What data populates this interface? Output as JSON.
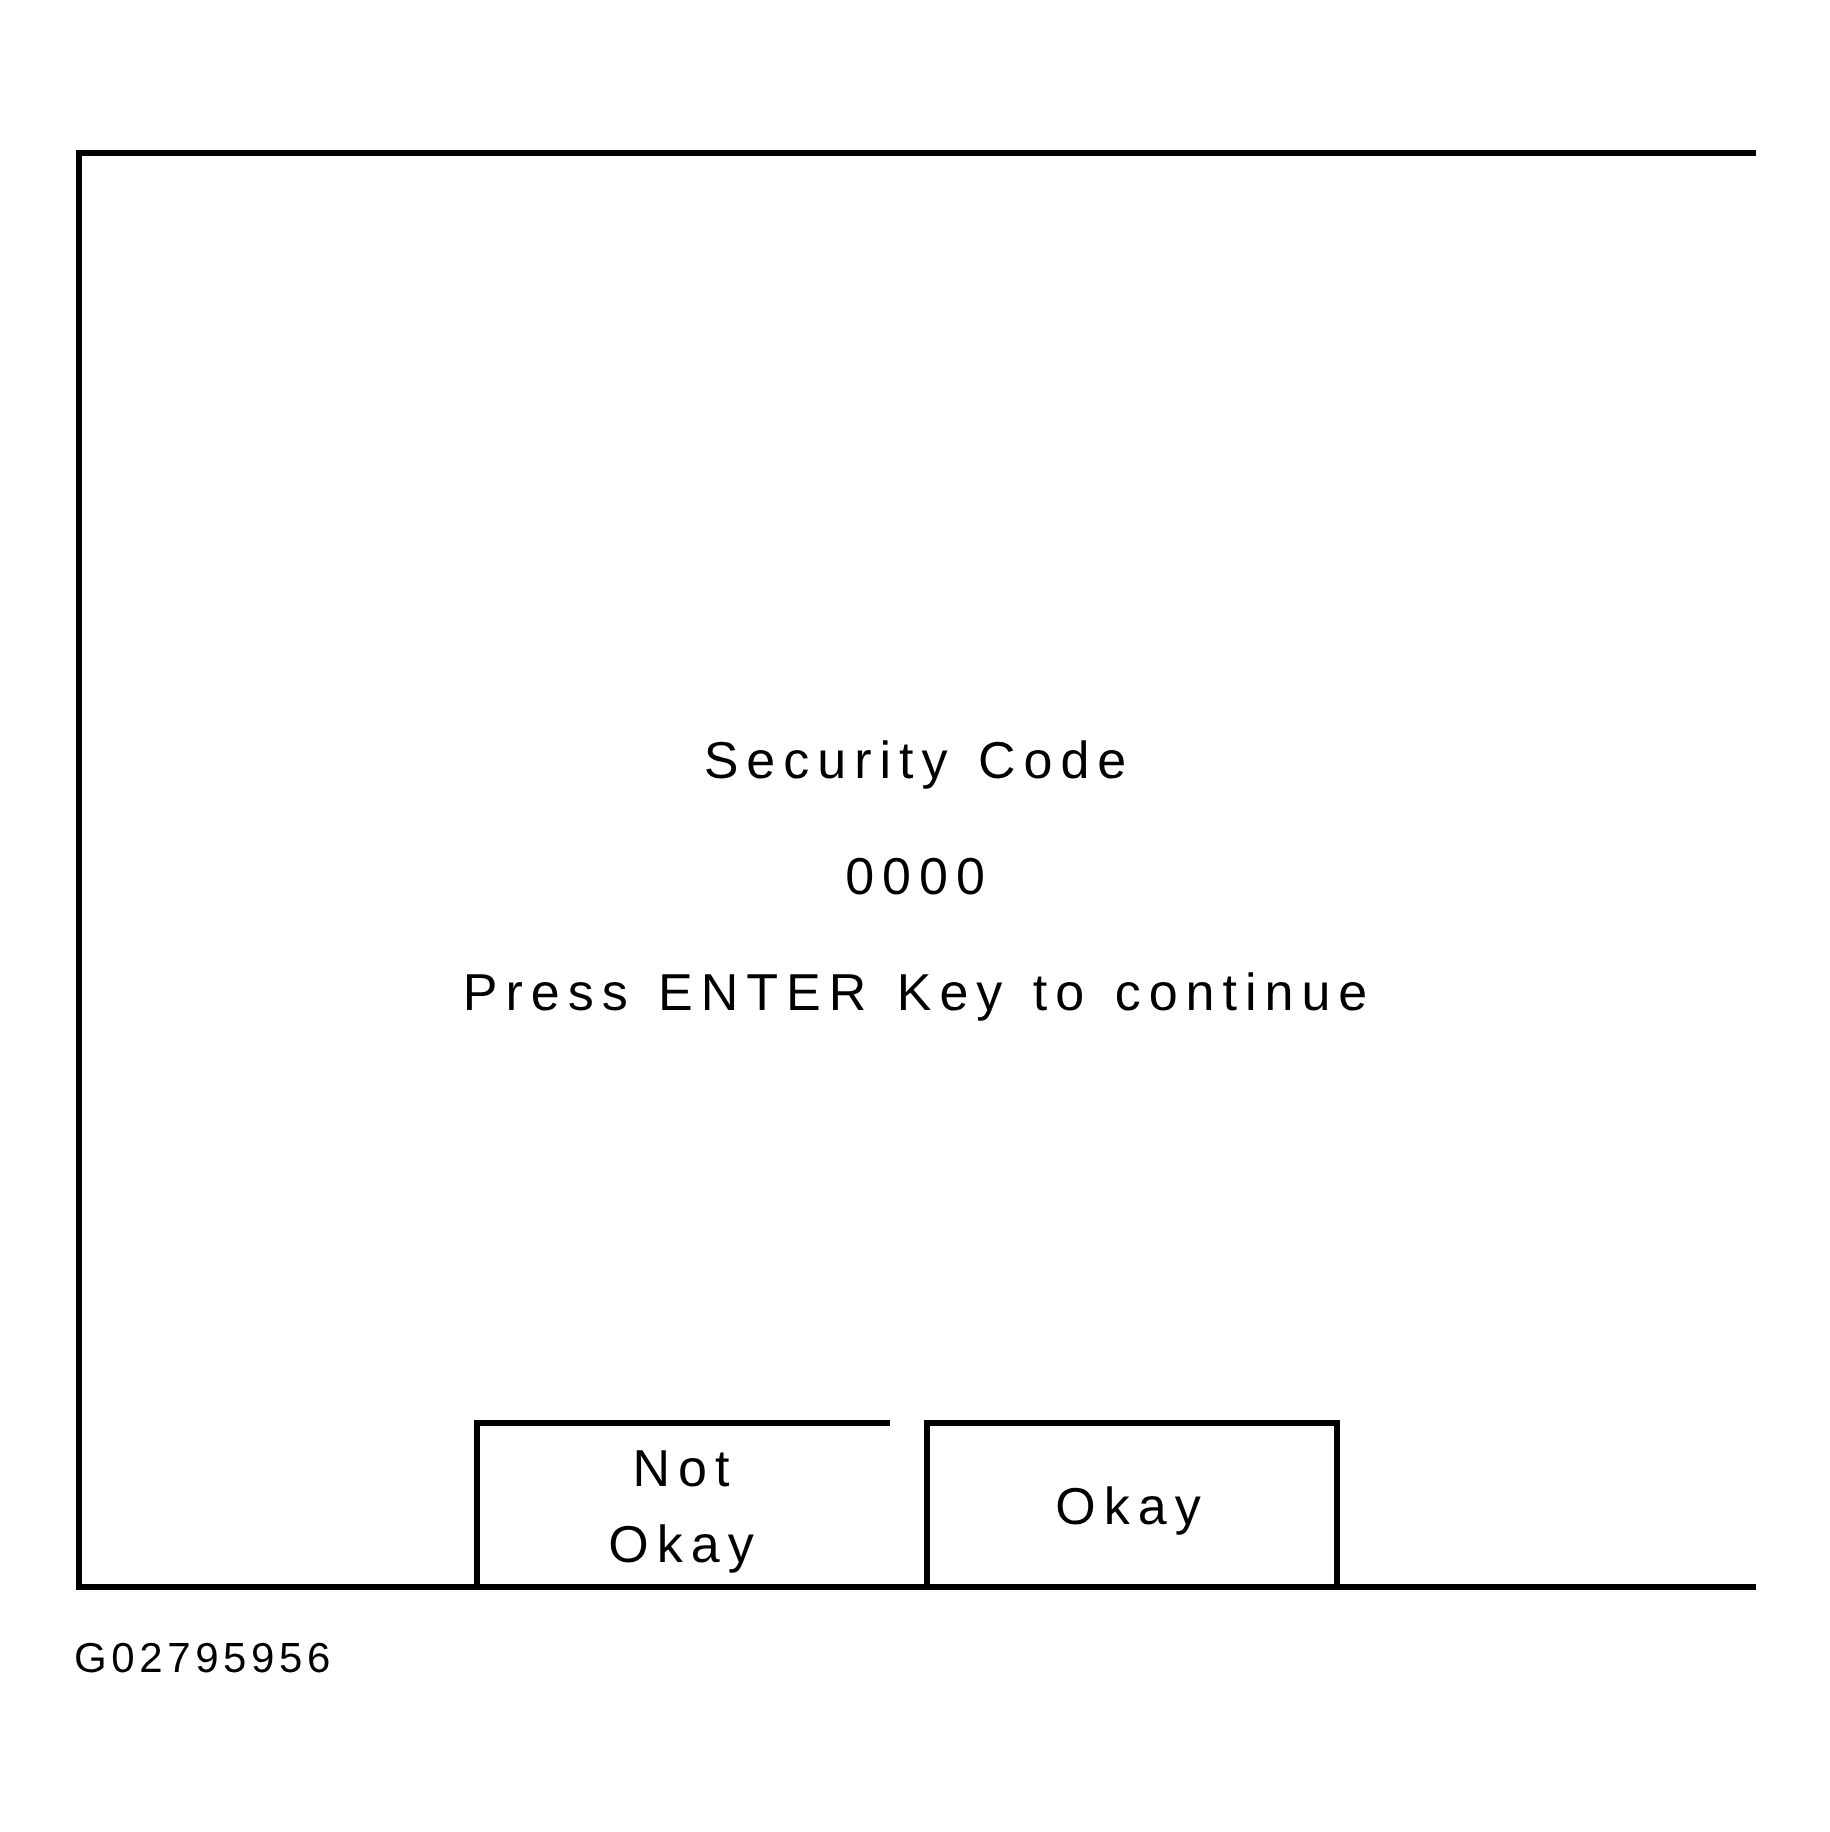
{
  "screen": {
    "title": "Security Code",
    "code": "0000",
    "prompt": "Press ENTER Key to continue",
    "buttons": [
      {
        "label": "Not Okay"
      },
      {
        "label": "Okay"
      }
    ]
  },
  "figure_id": "G02795956"
}
